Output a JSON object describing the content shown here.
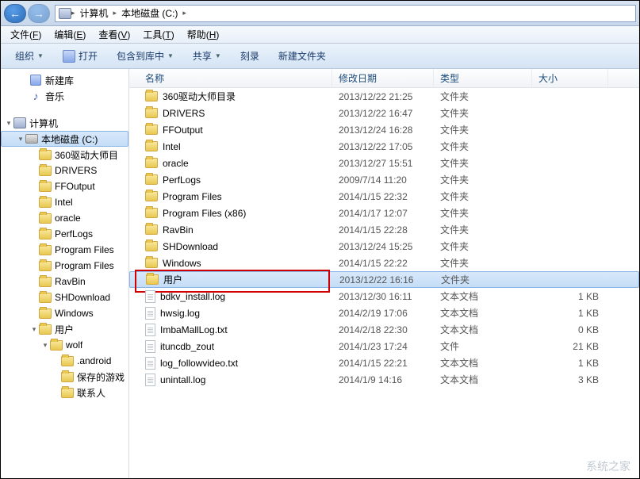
{
  "breadcrumb": [
    {
      "label": "计算机",
      "icon": "computer"
    },
    {
      "label": "本地磁盘 (C:)",
      "icon": null
    }
  ],
  "menubar": [
    {
      "label": "文件",
      "key": "F"
    },
    {
      "label": "编辑",
      "key": "E"
    },
    {
      "label": "查看",
      "key": "V"
    },
    {
      "label": "工具",
      "key": "T"
    },
    {
      "label": "帮助",
      "key": "H"
    }
  ],
  "toolbar": {
    "organize": "组织",
    "open": "打开",
    "include": "包含到库中",
    "share": "共享",
    "burn": "刻录",
    "newfolder": "新建文件夹"
  },
  "sidebar": [
    {
      "label": "新建库",
      "icon": "lib",
      "indent": 24,
      "arrow": ""
    },
    {
      "label": "音乐",
      "icon": "music",
      "indent": 24,
      "arrow": ""
    },
    {
      "label": "",
      "icon": "",
      "indent": 0,
      "arrow": ""
    },
    {
      "label": "计算机",
      "icon": "computer",
      "indent": 4,
      "arrow": "▾"
    },
    {
      "label": "本地磁盘 (C:)",
      "icon": "drive",
      "indent": 18,
      "arrow": "▾",
      "selected": true
    },
    {
      "label": "360驱动大师目",
      "icon": "folder",
      "indent": 36,
      "arrow": ""
    },
    {
      "label": "DRIVERS",
      "icon": "folder",
      "indent": 36,
      "arrow": ""
    },
    {
      "label": "FFOutput",
      "icon": "folder",
      "indent": 36,
      "arrow": ""
    },
    {
      "label": "Intel",
      "icon": "folder",
      "indent": 36,
      "arrow": ""
    },
    {
      "label": "oracle",
      "icon": "folder",
      "indent": 36,
      "arrow": ""
    },
    {
      "label": "PerfLogs",
      "icon": "folder",
      "indent": 36,
      "arrow": ""
    },
    {
      "label": "Program Files",
      "icon": "folder",
      "indent": 36,
      "arrow": ""
    },
    {
      "label": "Program Files",
      "icon": "folder",
      "indent": 36,
      "arrow": ""
    },
    {
      "label": "RavBin",
      "icon": "folder",
      "indent": 36,
      "arrow": ""
    },
    {
      "label": "SHDownload",
      "icon": "folder",
      "indent": 36,
      "arrow": ""
    },
    {
      "label": "Windows",
      "icon": "folder",
      "indent": 36,
      "arrow": ""
    },
    {
      "label": "用户",
      "icon": "folder",
      "indent": 36,
      "arrow": "▾"
    },
    {
      "label": "wolf",
      "icon": "folder",
      "indent": 50,
      "arrow": "▾"
    },
    {
      "label": ".android",
      "icon": "folder",
      "indent": 64,
      "arrow": ""
    },
    {
      "label": "保存的游戏",
      "icon": "folder",
      "indent": 64,
      "arrow": ""
    },
    {
      "label": "联系人",
      "icon": "folder",
      "indent": 64,
      "arrow": ""
    }
  ],
  "columns": {
    "name": "名称",
    "date": "修改日期",
    "type": "类型",
    "size": "大小"
  },
  "files": [
    {
      "name": "360驱动大师目录",
      "date": "2013/12/22 21:25",
      "type": "文件夹",
      "size": "",
      "isFolder": true
    },
    {
      "name": "DRIVERS",
      "date": "2013/12/22 16:47",
      "type": "文件夹",
      "size": "",
      "isFolder": true
    },
    {
      "name": "FFOutput",
      "date": "2013/12/24 16:28",
      "type": "文件夹",
      "size": "",
      "isFolder": true
    },
    {
      "name": "Intel",
      "date": "2013/12/22 17:05",
      "type": "文件夹",
      "size": "",
      "isFolder": true
    },
    {
      "name": "oracle",
      "date": "2013/12/27 15:51",
      "type": "文件夹",
      "size": "",
      "isFolder": true
    },
    {
      "name": "PerfLogs",
      "date": "2009/7/14 11:20",
      "type": "文件夹",
      "size": "",
      "isFolder": true
    },
    {
      "name": "Program Files",
      "date": "2014/1/15 22:32",
      "type": "文件夹",
      "size": "",
      "isFolder": true
    },
    {
      "name": "Program Files (x86)",
      "date": "2014/1/17 12:07",
      "type": "文件夹",
      "size": "",
      "isFolder": true
    },
    {
      "name": "RavBin",
      "date": "2014/1/15 22:28",
      "type": "文件夹",
      "size": "",
      "isFolder": true
    },
    {
      "name": "SHDownload",
      "date": "2013/12/24 15:25",
      "type": "文件夹",
      "size": "",
      "isFolder": true
    },
    {
      "name": "Windows",
      "date": "2014/1/15 22:22",
      "type": "文件夹",
      "size": "",
      "isFolder": true
    },
    {
      "name": "用户",
      "date": "2013/12/22 16:16",
      "type": "文件夹",
      "size": "",
      "isFolder": true,
      "selected": true,
      "highlighted": true
    },
    {
      "name": "bdkv_install.log",
      "date": "2013/12/30 16:11",
      "type": "文本文档",
      "size": "1 KB",
      "isFolder": false
    },
    {
      "name": "hwsig.log",
      "date": "2014/2/19 17:06",
      "type": "文本文档",
      "size": "1 KB",
      "isFolder": false
    },
    {
      "name": "ImbaMallLog.txt",
      "date": "2014/2/18 22:30",
      "type": "文本文档",
      "size": "0 KB",
      "isFolder": false
    },
    {
      "name": "ituncdb_zout",
      "date": "2014/1/23 17:24",
      "type": "文件",
      "size": "21 KB",
      "isFolder": false
    },
    {
      "name": "log_followvideo.txt",
      "date": "2014/1/15 22:21",
      "type": "文本文档",
      "size": "1 KB",
      "isFolder": false
    },
    {
      "name": "unintall.log",
      "date": "2014/1/9 14:16",
      "type": "文本文档",
      "size": "3 KB",
      "isFolder": false
    }
  ],
  "watermark": "系统之家"
}
